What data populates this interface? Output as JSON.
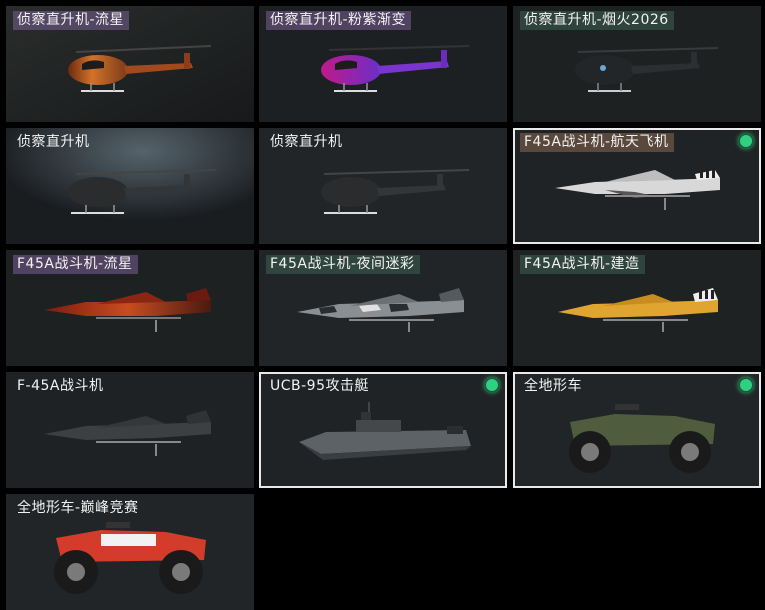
{
  "vehicles": [
    {
      "name": "侦察直升机-流星",
      "icon": "helicopter-icon",
      "skin": "meteor",
      "tag_style": "purple",
      "selected": false
    },
    {
      "name": "侦察直升机-粉紫渐变",
      "icon": "helicopter-icon",
      "skin": "pink-purple",
      "tag_style": "purple",
      "selected": false
    },
    {
      "name": "侦察直升机-烟火2026",
      "icon": "helicopter-icon",
      "skin": "fireworks",
      "tag_style": "green",
      "selected": false
    },
    {
      "name": "侦察直升机",
      "icon": "helicopter-icon",
      "skin": "default",
      "tag_style": "none",
      "selected": false
    },
    {
      "name": "侦察直升机",
      "icon": "helicopter-icon",
      "skin": "default",
      "tag_style": "none",
      "selected": false
    },
    {
      "name": "F45A战斗机-航天飞机",
      "icon": "fighter-jet-icon",
      "skin": "space-shuttle",
      "tag_style": "brown",
      "selected": true
    },
    {
      "name": "F45A战斗机-流星",
      "icon": "fighter-jet-icon",
      "skin": "meteor",
      "tag_style": "purple",
      "selected": false
    },
    {
      "name": "F45A战斗机-夜间迷彩",
      "icon": "fighter-jet-icon",
      "skin": "night-camo",
      "tag_style": "green",
      "selected": false
    },
    {
      "name": "F45A战斗机-建造",
      "icon": "fighter-jet-icon",
      "skin": "construction",
      "tag_style": "green",
      "selected": false
    },
    {
      "name": "F-45A战斗机",
      "icon": "fighter-jet-icon",
      "skin": "default",
      "tag_style": "none",
      "selected": false
    },
    {
      "name": "UCB-95攻击艇",
      "icon": "attack-boat-icon",
      "skin": "default",
      "tag_style": "none",
      "selected": true
    },
    {
      "name": "全地形车",
      "icon": "atv-icon",
      "skin": "default",
      "tag_style": "none",
      "selected": true
    },
    {
      "name": "全地形车-巅峰竞赛",
      "icon": "atv-icon",
      "skin": "peak-race",
      "tag_style": "none",
      "selected": false
    }
  ],
  "colors": {
    "background": "#000000",
    "selected_border": "#e9e9e9",
    "equipped_dot": "#2fd07f"
  }
}
